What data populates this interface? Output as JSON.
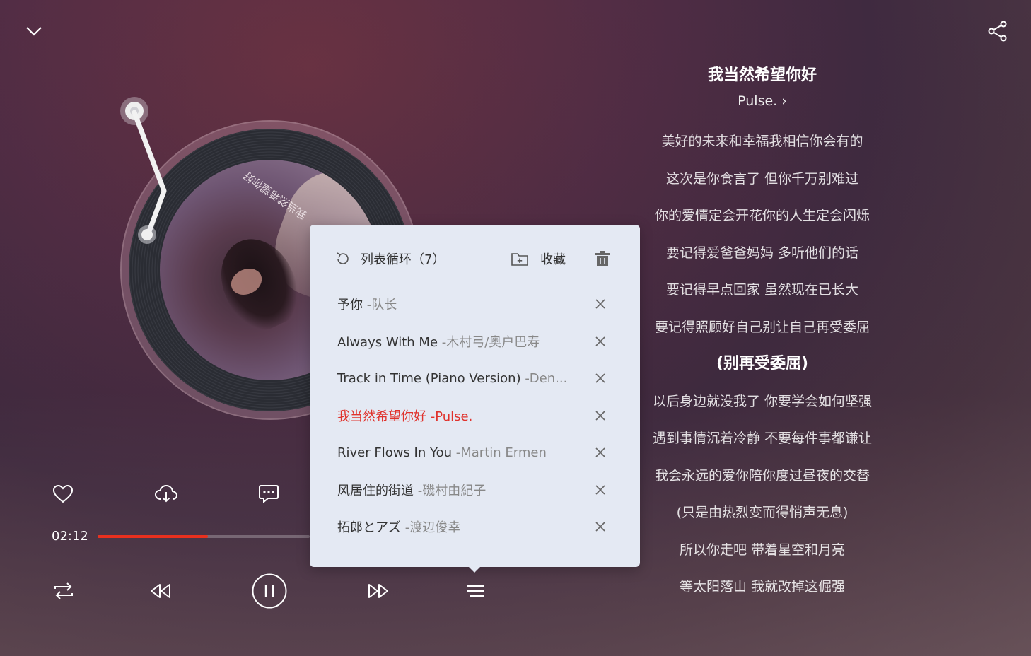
{
  "colors": {
    "accent": "#e8301e",
    "current_track": "#e0322c",
    "popup_bg": "#e4e9f3"
  },
  "top": {
    "collapse_icon": "chevron-down-icon",
    "share_icon": "share-icon"
  },
  "album_art": {
    "art_text": "我当然希望你好"
  },
  "actions": [
    {
      "name": "like-button",
      "icon": "heart-icon"
    },
    {
      "name": "download-button",
      "icon": "cloud-download-icon"
    },
    {
      "name": "comment-button",
      "icon": "comment-icon"
    }
  ],
  "progress": {
    "current_time": "02:12",
    "fraction": 0.52
  },
  "controls": {
    "mode_icon": "repeat-icon",
    "prev_icon": "rewind-icon",
    "play_icon": "pause-icon",
    "next_icon": "fast-forward-icon",
    "playlist_icon": "playlist-icon"
  },
  "song": {
    "title": "我当然希望你好",
    "artist": "Pulse. ›"
  },
  "lyrics": [
    "美好的未来和幸福我相信你会有的",
    "这次是你食言了 但你千万别难过",
    "你的爱情定会开花你的人生定会闪烁",
    "要记得爱爸爸妈妈 多听他们的话",
    "要记得早点回家 虽然现在已长大",
    "要记得照顾好自己别让自己再受委屈",
    "(别再受委屈)",
    "以后身边就没我了 你要学会如何坚强",
    "遇到事情沉着冷静 不要每件事都谦让",
    "我会永远的爱你陪你度过昼夜的交替",
    "(只是由热烈变而得悄声无息)",
    "所以你走吧 带着星空和月亮",
    "等太阳落山 我就改掉这倔强"
  ],
  "active_lyric_index": 6,
  "playlist": {
    "mode_label": "列表循环（7）",
    "collect_label": "收藏",
    "tracks": [
      {
        "title": "予你",
        "artist": " -队长"
      },
      {
        "title": "Always With Me",
        "artist": " -木村弓/奥户巴寿"
      },
      {
        "title": "Track in Time (Piano Version)",
        "artist": " -Den..."
      },
      {
        "title": "我当然希望你好",
        "artist": " -Pulse."
      },
      {
        "title": "River Flows In You",
        "artist": " -Martin Ermen"
      },
      {
        "title": "风居住的街道",
        "artist": " -磯村由紀子"
      },
      {
        "title": "拓郎とアズ",
        "artist": " -渡辺俊幸"
      }
    ],
    "current_index": 3
  }
}
